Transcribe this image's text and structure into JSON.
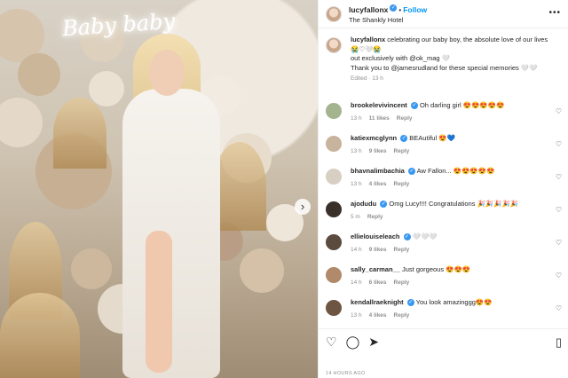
{
  "header": {
    "username": "lucyfallonx",
    "follow_label": "Follow",
    "location": "The Shankly Hotel",
    "verified_glyph": "✓",
    "more_glyph": "•••"
  },
  "photo": {
    "neon_text": "Baby baby",
    "next_glyph": "›"
  },
  "caption": {
    "username": "lucyfallonx",
    "line1": "celebrating our baby boy, the absolute love of our lives",
    "line2": "😭♡🤍😭",
    "line3": "out exclusively with @ok_mag 🤍",
    "line4": "Thank you to @jamesrudland for these special memories 🤍🤍",
    "meta": "Edited · 13 h"
  },
  "comments": [
    {
      "username": "brookelevivincent",
      "text": "Oh darling girl 😍😍😍😍😍",
      "time": "13 h",
      "likes": "11 likes",
      "reply": "Reply",
      "verified": true
    },
    {
      "username": "katiexmcglynn",
      "text": "BEAutiful 😍💙",
      "time": "13 h",
      "likes": "9 likes",
      "reply": "Reply",
      "verified": true
    },
    {
      "username": "bhavnalimbachia",
      "text": "Aw Fallon... 😍😍😍😍😍",
      "time": "13 h",
      "likes": "4 likes",
      "reply": "Reply",
      "verified": true
    },
    {
      "username": "ajodudu",
      "text": "Omg Lucy!!!! Congratulations 🎉🎉🎉🎉🎉",
      "time": "5 m",
      "likes": "",
      "reply": "Reply",
      "verified": true
    },
    {
      "username": "ellielouiseleach",
      "text": "🤍🤍🤍",
      "time": "14 h",
      "likes": "9 likes",
      "reply": "Reply",
      "verified": true
    },
    {
      "username": "sally_carman__",
      "text": "Just gorgeous 😍😍😍",
      "time": "14 h",
      "likes": "6 likes",
      "reply": "Reply",
      "verified": false
    },
    {
      "username": "kendallraeknight",
      "text": "You look amazinggg😍😍",
      "time": "13 h",
      "likes": "4 likes",
      "reply": "Reply",
      "verified": true
    }
  ],
  "actions": {
    "like_glyph": "♡",
    "comment_glyph": "◯",
    "share_glyph": "➤",
    "save_glyph": "▯",
    "heart_glyph": "♡"
  },
  "footer": {
    "time_ago": "14 HOURS AGO"
  }
}
